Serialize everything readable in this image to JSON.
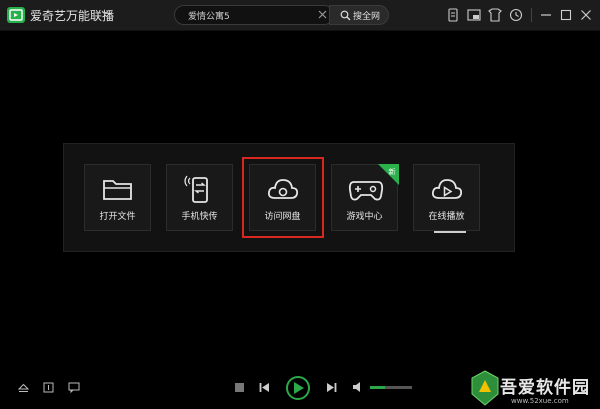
{
  "app": {
    "title": "爱奇艺万能联播"
  },
  "search": {
    "query": "爱情公寓5",
    "button_label": "搜全网"
  },
  "toolbar": {
    "icons": [
      "phone-transfer-icon",
      "mini-mode-icon",
      "shop-icon",
      "history-clock-icon",
      "minimize-icon",
      "maximize-icon",
      "close-icon"
    ]
  },
  "tiles": [
    {
      "label": "打开文件",
      "icon": "folder-icon"
    },
    {
      "label": "手机快传",
      "icon": "phone-transfer-icon"
    },
    {
      "label": "访问网盘",
      "icon": "cloud-icon",
      "highlighted": true
    },
    {
      "label": "游戏中心",
      "icon": "gamepad-icon",
      "badge": "新"
    },
    {
      "label": "在线播放",
      "icon": "cloud-play-icon"
    }
  ],
  "player": {
    "volume_fraction": 0.35,
    "accent": "#2ba84a"
  },
  "watermark": {
    "name": "吾爱软件园",
    "url": "www.52xue.com"
  },
  "colors": {
    "accent": "#26b14d",
    "highlight": "#d6281f"
  }
}
